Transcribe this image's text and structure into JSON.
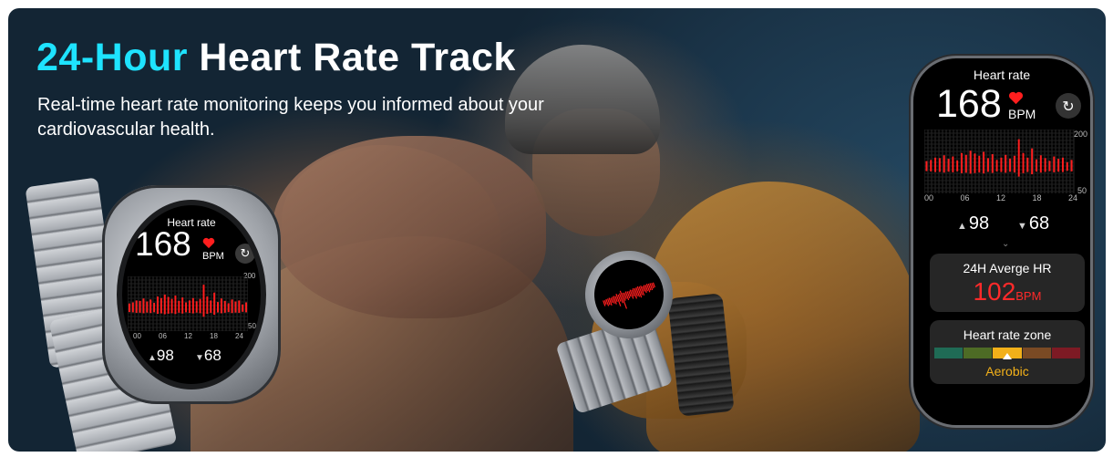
{
  "banner": {
    "title_accent": "24-Hour",
    "title_rest": " Heart Rate Track",
    "subtitle": "Real-time heart rate monitoring keeps you informed about your cardiovascular health.",
    "accent_color": "#1ee3ff"
  },
  "watch": {
    "title": "Heart rate",
    "bpm": "168",
    "unit": "BPM",
    "refresh_icon": "refresh-icon",
    "heart_icon": "heart-icon",
    "heart_color": "#ff1e1e",
    "y_max_label": "200",
    "y_min_label": "50",
    "x_ticks": [
      "00",
      "06",
      "12",
      "18",
      "24"
    ],
    "min_value": "98",
    "max_value": "68",
    "min_arrow": "▲",
    "max_arrow": "▼"
  },
  "panel": {
    "title": "Heart rate",
    "bpm": "168",
    "unit": "BPM",
    "y_max_label": "200",
    "y_min_label": "50",
    "x_ticks": [
      "00",
      "06",
      "12",
      "18",
      "24"
    ],
    "min_value": "98",
    "max_value": "68",
    "min_arrow": "▲",
    "max_arrow": "▼",
    "chevron": "⌄",
    "avg_label": "24H Averge HR",
    "avg_value": "102",
    "avg_unit": "BPM",
    "zone_label": "Heart rate zone",
    "zone_name": "Aerobic",
    "zone_colors": [
      "#1f6b55",
      "#4d6b25",
      "#f2b019",
      "#7a4a24",
      "#7d1a24"
    ],
    "active_zone_index": 2
  },
  "chart_data": {
    "type": "bar",
    "color": "#ff1e1e",
    "x": [
      0,
      1,
      2,
      3,
      4,
      5,
      6,
      7,
      8,
      9,
      10,
      11,
      12,
      13,
      14,
      15,
      16,
      17,
      18,
      19,
      20,
      21,
      22,
      23,
      24,
      25,
      26,
      27,
      28,
      29,
      30,
      31,
      32,
      33
    ],
    "values": [
      85,
      90,
      100,
      98,
      110,
      95,
      105,
      88,
      120,
      112,
      130,
      118,
      108,
      125,
      98,
      115,
      90,
      100,
      112,
      96,
      108,
      180,
      120,
      100,
      140,
      92,
      110,
      98,
      86,
      105,
      95,
      100,
      80,
      90
    ],
    "ylim": [
      50,
      200
    ],
    "xlim": [
      0,
      33
    ],
    "x_tick_labels": [
      "00",
      "06",
      "12",
      "18",
      "24"
    ],
    "y_tick_labels": [
      "200",
      "50"
    ],
    "grid": true
  }
}
